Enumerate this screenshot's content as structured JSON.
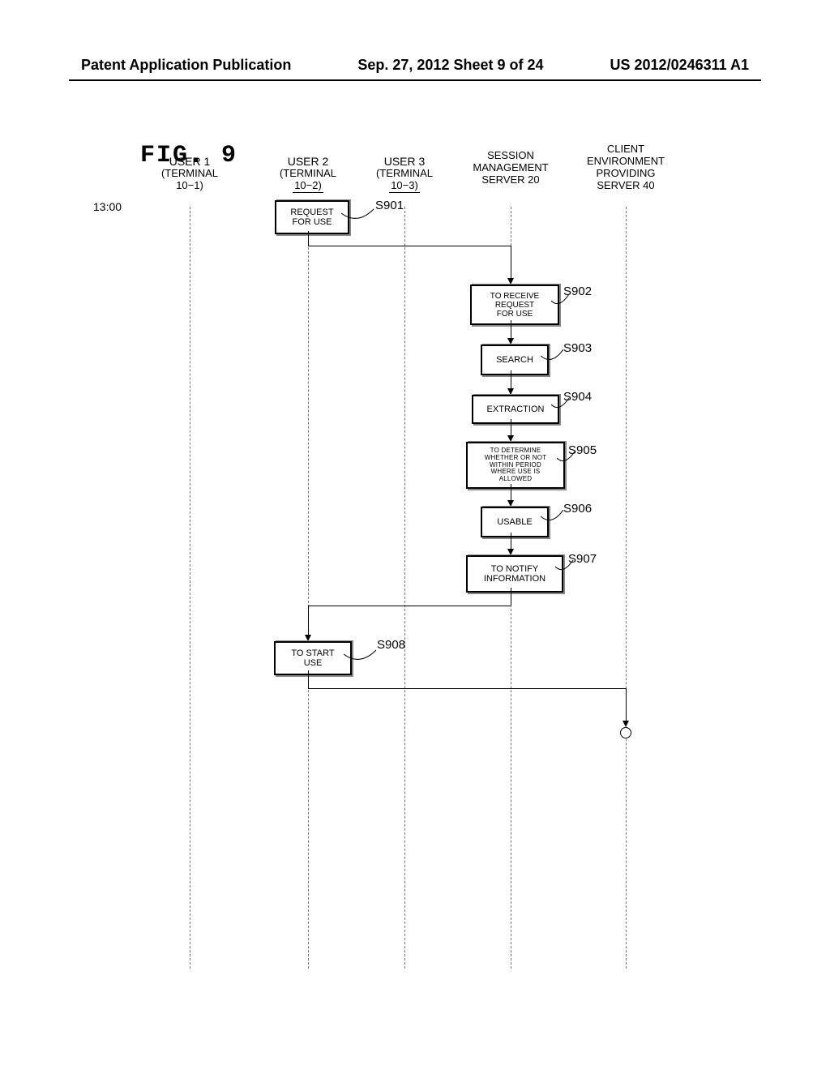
{
  "header": {
    "left": "Patent Application Publication",
    "center": "Sep. 27, 2012  Sheet 9 of 24",
    "right": "US 2012/0246311 A1"
  },
  "figure_label": "FIG.  9",
  "time_label": "13:00",
  "lanes": {
    "user1": {
      "name": "USER 1",
      "terminal_line1": "(TERMINAL",
      "terminal_line2": "10−1)"
    },
    "user2": {
      "name": "USER 2",
      "terminal_line1": "(TERMINAL",
      "terminal_line2": "10−2)"
    },
    "user3": {
      "name": "USER 3",
      "terminal_line1": "(TERMINAL",
      "terminal_line2": "10−3)"
    },
    "session": {
      "line1": "SESSION",
      "line2": "MANAGEMENT",
      "line3": "SERVER 20"
    },
    "client": {
      "line1": "CLIENT",
      "line2": "ENVIRONMENT",
      "line3": "PROVIDING",
      "line4": "SERVER 40"
    }
  },
  "steps": {
    "s901": {
      "label": "S901",
      "text": "REQUEST\nFOR USE"
    },
    "s902": {
      "label": "S902",
      "text": "TO RECEIVE\nREQUEST\nFOR USE"
    },
    "s903": {
      "label": "S903",
      "text": "SEARCH"
    },
    "s904": {
      "label": "S904",
      "text": "EXTRACTION"
    },
    "s905": {
      "label": "S905",
      "text": "TO DETERMINE\nWHETHER OR NOT\nWITHIN PERIOD\nWHERE USE IS\nALLOWED"
    },
    "s906": {
      "label": "S906",
      "text": "USABLE"
    },
    "s907": {
      "label": "S907",
      "text": "TO NOTIFY\nINFORMATION"
    },
    "s908": {
      "label": "S908",
      "text": "TO START\nUSE"
    }
  }
}
